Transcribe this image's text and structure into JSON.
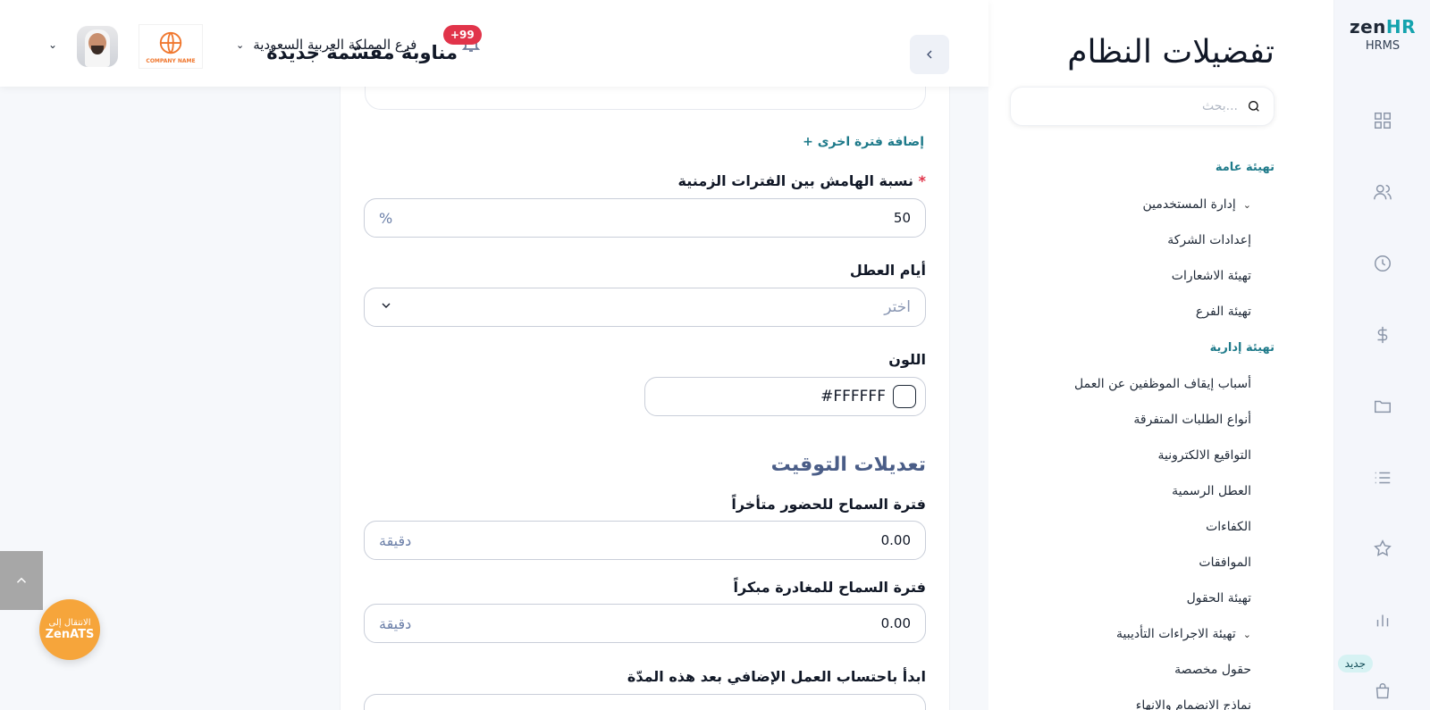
{
  "rail": {
    "logo_zen": "zen",
    "logo_hr": "HR",
    "logo_sub": "HRMS",
    "icons": [
      "dashboard-icon",
      "users-icon",
      "clock-icon",
      "dollar-icon",
      "folder-icon",
      "list-icon",
      "star-icon",
      "chart-icon",
      "bag-icon"
    ],
    "new_badge": "جديد"
  },
  "settings": {
    "title": "تفضيلات النظام",
    "search_placeholder": "بحث...",
    "section_general": "تهيئة عامة",
    "section_admin": "تهيئة إدارية",
    "general_items": [
      "إدارة المستخدمين",
      "إعدادات الشركة",
      "تهيئة الاشعارات",
      "تهيئة الفرع"
    ],
    "admin_items": [
      "أسباب إيقاف الموظفين عن العمل",
      "أنواع الطلبات المتفرقة",
      "التواقيع الالكترونية",
      "العطل الرسمية",
      "الكفاءات",
      "الموافقات",
      "تهيئة الحقول",
      "تهيئة الاجراءات التأديبية",
      "حقول مخصصة",
      "نماذج الانضمام والانهاء"
    ]
  },
  "header": {
    "title": "مناوبة مقسّمة جديدة",
    "notifications": "+99",
    "branch": "فرع المملكة العربية السعودية",
    "company_logo_text": "COMPANY NAME"
  },
  "form": {
    "add_period": "+ إضافة فترة اخرى",
    "margin_label": "نسبة الهامش بين الفترات الزمنية",
    "required_mark": "*",
    "margin_value": "50",
    "margin_unit": "%",
    "holidays_label": "أيام العطل",
    "holidays_placeholder": "اختر",
    "color_label": "اللون",
    "color_value": "#FFFFFF",
    "timing_section": "تعديلات التوقيت",
    "late_label": "فترة السماح للحضور متأخراً",
    "late_value": "0.00",
    "late_unit": "دقيقة",
    "early_label": "فترة السماح للمغادرة مبكراً",
    "early_value": "0.00",
    "early_unit": "دقيقة",
    "overtime_label": "ابدأ باحتساب العمل الإضافي بعد هذه المدّة"
  },
  "floating": {
    "zenats_line1": "الانتقال إلى",
    "zenats_line2": "ZenATS"
  }
}
